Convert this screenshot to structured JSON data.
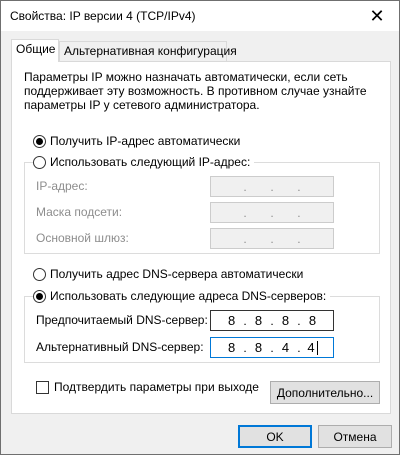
{
  "window": {
    "title": "Свойства: IP версии 4 (TCP/IPv4)",
    "close_glyph": "✕"
  },
  "tabs": [
    {
      "label": "Общие",
      "active": true
    },
    {
      "label": "Альтернативная конфигурация",
      "active": false
    }
  ],
  "general": {
    "description": "Параметры IP можно назначать автоматически, если сеть поддерживает эту возможность. В противном случае узнайте параметры IP у сетевого администратора.",
    "ip_auto_label": "Получить IP-адрес автоматически",
    "ip_auto_selected": true,
    "ip_manual_label": "Использовать следующий IP-адрес:",
    "ip_manual_selected": false,
    "ip_fields": [
      {
        "label": "IP-адрес:",
        "octets": [
          "",
          "",
          "",
          ""
        ]
      },
      {
        "label": "Маска подсети:",
        "octets": [
          "",
          "",
          "",
          ""
        ]
      },
      {
        "label": "Основной шлюз:",
        "octets": [
          "",
          "",
          "",
          ""
        ]
      }
    ],
    "dns_auto_label": "Получить адрес DNS-сервера автоматически",
    "dns_auto_selected": false,
    "dns_manual_label": "Использовать следующие адреса DNS-серверов:",
    "dns_manual_selected": true,
    "dns_fields": [
      {
        "label": "Предпочитаемый DNS-сервер:",
        "octets": [
          "8",
          "8",
          "8",
          "8"
        ]
      },
      {
        "label": "Альтернативный DNS-сервер:",
        "octets": [
          "8",
          "8",
          "4",
          "4"
        ]
      }
    ],
    "validate_label": "Подтвердить параметры при выходе",
    "validate_checked": false,
    "advanced_label": "Дополнительно..."
  },
  "buttons": {
    "ok_label": "OK",
    "cancel_label": "Отмена"
  },
  "colors": {
    "focus_border": "#0078d7",
    "disabled_text": "#8d8d8d"
  }
}
